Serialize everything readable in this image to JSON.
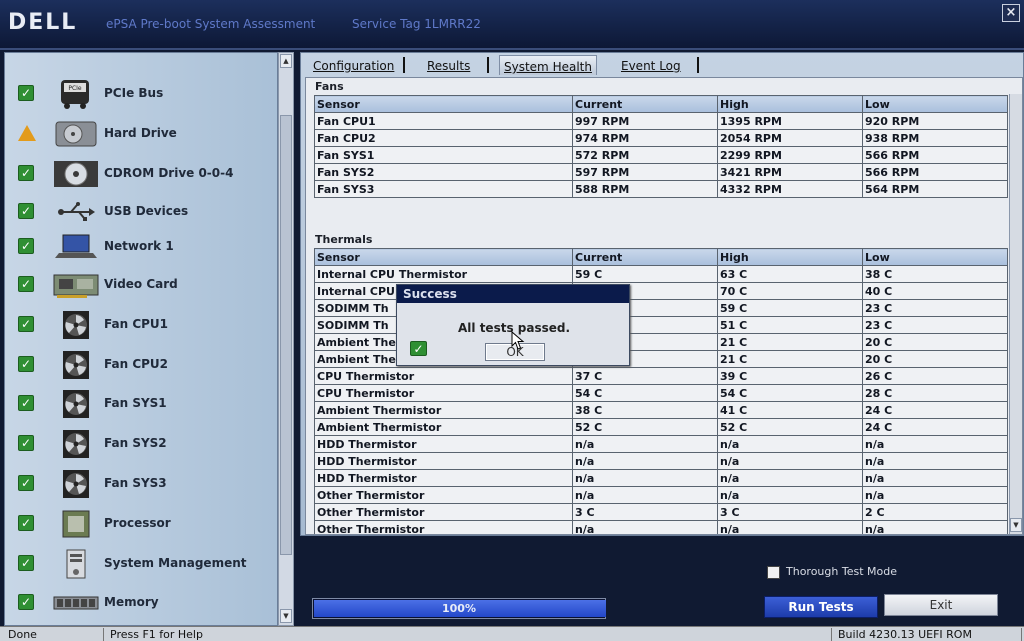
{
  "titlebar": {
    "logo": "DELL",
    "app_title": "ePSA Pre-boot System Assessment",
    "service_tag": "Service Tag 1LMRR22"
  },
  "sidebar": {
    "items": [
      {
        "label": "PCIe Bus",
        "status": "pass",
        "icon": "pcie-bus-icon"
      },
      {
        "label": "Hard Drive",
        "status": "warning",
        "icon": "hard-drive-icon"
      },
      {
        "label": "CDROM Drive 0-0-4",
        "status": "pass",
        "icon": "cdrom-drive-icon"
      },
      {
        "label": "USB Devices",
        "status": "pass",
        "icon": "usb-icon"
      },
      {
        "label": "Network 1",
        "status": "pass",
        "icon": "network-laptop-icon"
      },
      {
        "label": "Video Card",
        "status": "pass",
        "icon": "video-card-icon"
      },
      {
        "label": "Fan CPU1",
        "status": "pass",
        "icon": "fan-icon"
      },
      {
        "label": "Fan CPU2",
        "status": "pass",
        "icon": "fan-icon"
      },
      {
        "label": "Fan SYS1",
        "status": "pass",
        "icon": "fan-icon"
      },
      {
        "label": "Fan SYS2",
        "status": "pass",
        "icon": "fan-icon"
      },
      {
        "label": "Fan SYS3",
        "status": "pass",
        "icon": "fan-icon"
      },
      {
        "label": "Processor",
        "status": "pass",
        "icon": "processor-chip-icon"
      },
      {
        "label": "System Management",
        "status": "pass",
        "icon": "system-management-icon"
      },
      {
        "label": "Memory",
        "status": "pass",
        "icon": "memory-module-icon"
      }
    ]
  },
  "tabs": [
    {
      "label": "Configuration",
      "active": false
    },
    {
      "label": "Results",
      "active": false
    },
    {
      "label": "System Health",
      "active": true
    },
    {
      "label": "Event Log",
      "active": false
    }
  ],
  "fans": {
    "title": "Fans",
    "headers": [
      "Sensor",
      "Current",
      "High",
      "Low"
    ],
    "rows": [
      [
        "Fan CPU1",
        "997 RPM",
        "1395 RPM",
        "920 RPM"
      ],
      [
        "Fan CPU2",
        "974 RPM",
        "2054 RPM",
        "938 RPM"
      ],
      [
        "Fan SYS1",
        "572 RPM",
        "2299 RPM",
        "566 RPM"
      ],
      [
        "Fan SYS2",
        "597 RPM",
        "3421 RPM",
        "566 RPM"
      ],
      [
        "Fan SYS3",
        "588 RPM",
        "4332 RPM",
        "564 RPM"
      ]
    ]
  },
  "thermals": {
    "title": "Thermals",
    "headers": [
      "Sensor",
      "Current",
      "High",
      "Low"
    ],
    "rows": [
      [
        "Internal CPU Thermistor",
        "59 C",
        "63 C",
        "38 C"
      ],
      [
        "Internal CPU",
        "",
        "70 C",
        "40 C"
      ],
      [
        "SODIMM Th",
        "",
        "59 C",
        "23 C"
      ],
      [
        "SODIMM Th",
        "",
        "51 C",
        "23 C"
      ],
      [
        "Ambient The",
        "",
        "21 C",
        "20 C"
      ],
      [
        "Ambient The",
        "",
        "21 C",
        "20 C"
      ],
      [
        "CPU Thermistor",
        "37 C",
        "39 C",
        "26 C"
      ],
      [
        "CPU Thermistor",
        "54 C",
        "54 C",
        "28 C"
      ],
      [
        "Ambient Thermistor",
        "38 C",
        "41 C",
        "24 C"
      ],
      [
        "Ambient Thermistor",
        "52 C",
        "52 C",
        "24 C"
      ],
      [
        "HDD Thermistor",
        "n/a",
        "n/a",
        "n/a"
      ],
      [
        "HDD Thermistor",
        "n/a",
        "n/a",
        "n/a"
      ],
      [
        "HDD Thermistor",
        "n/a",
        "n/a",
        "n/a"
      ],
      [
        "Other Thermistor",
        "n/a",
        "n/a",
        "n/a"
      ],
      [
        "Other Thermistor",
        "3 C",
        "3 C",
        "2 C"
      ],
      [
        "Other Thermistor",
        "n/a",
        "n/a",
        "n/a"
      ]
    ]
  },
  "dialog": {
    "title": "Success",
    "message": "All tests passed.",
    "ok_label": "OK"
  },
  "bottom": {
    "thorough_label": "Thorough Test Mode",
    "thorough_checked": false,
    "progress_text": "100%",
    "progress_value": 100,
    "run_tests_label": "Run Tests",
    "exit_label": "Exit"
  },
  "statusbar": {
    "status": "Done",
    "help": "Press F1 for Help",
    "build": "Build  4230.13 UEFI ROM"
  },
  "colors": {
    "pass": "#2f8f33",
    "warning": "#e39b1b",
    "accent": "#2347c9"
  }
}
